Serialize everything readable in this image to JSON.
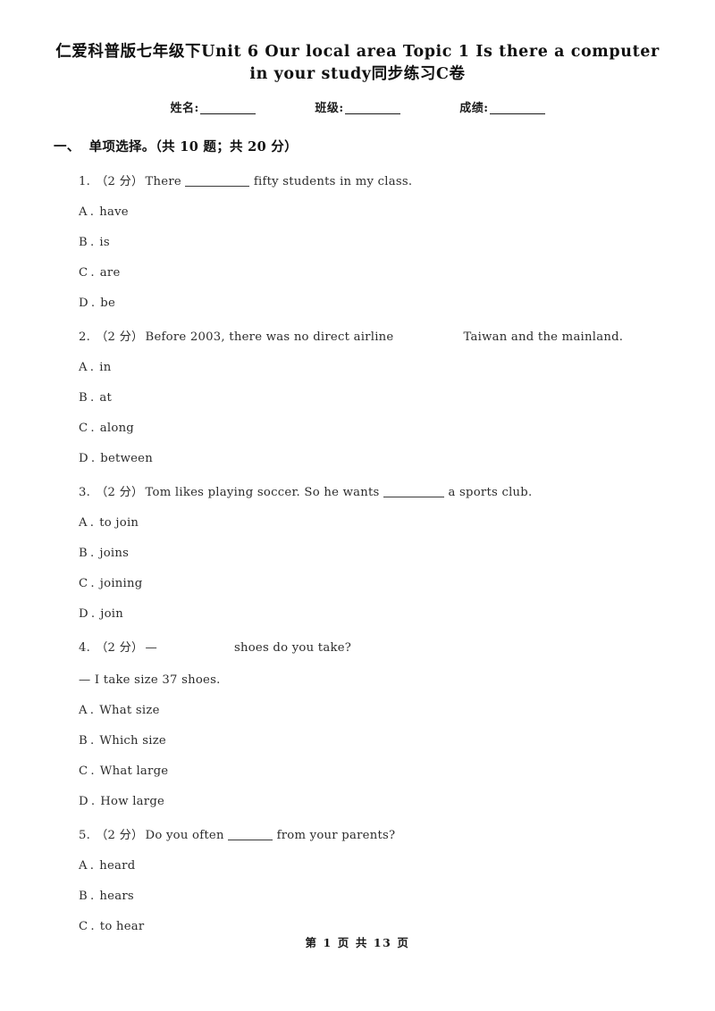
{
  "document": {
    "title": "仁爱科普版七年级下Unit 6 Our local area Topic 1 Is there a computer in your study同步练习C卷",
    "title_line1": "仁爱科普版七年级下Unit 6 Our local area Topic 1 Is there a computer",
    "title_line2": "in your study同步练习C卷"
  },
  "info_line": {
    "name_label": "姓名:",
    "class_label": "班级:",
    "score_label": "成绩:"
  },
  "section": {
    "number": "一、",
    "title": "单项选择。（共 10 题；共 20 分）"
  },
  "questions": [
    {
      "number": "1.",
      "score": "（2 分）",
      "text_before": "There ",
      "blank": "underline-long",
      "text_after": " fifty students in my class.",
      "continuation": null,
      "options": [
        {
          "letter": "A",
          "dot": ".",
          "text": "have"
        },
        {
          "letter": "B",
          "dot": ".",
          "text": "is"
        },
        {
          "letter": "C",
          "dot": ".",
          "text": "are"
        },
        {
          "letter": "D",
          "dot": ".",
          "text": "be"
        }
      ]
    },
    {
      "number": "2.",
      "score": "（2 分）",
      "text_before": "Before 2003, there was no direct airline",
      "blank": "gap-wide",
      "text_after": "Taiwan and the mainland.",
      "continuation": null,
      "options": [
        {
          "letter": "A",
          "dot": ".",
          "text": "in"
        },
        {
          "letter": "B",
          "dot": ".",
          "text": "at"
        },
        {
          "letter": "C",
          "dot": ".",
          "text": "along"
        },
        {
          "letter": "D",
          "dot": ".",
          "text": "between"
        }
      ]
    },
    {
      "number": "3.",
      "score": "（2 分）",
      "text_before": "Tom likes playing soccer. So he wants ",
      "blank": "underline-mid",
      "text_after": " a sports club.",
      "continuation": null,
      "options": [
        {
          "letter": "A",
          "dot": ".",
          "text": "to join"
        },
        {
          "letter": "B",
          "dot": ".",
          "text": "joins"
        },
        {
          "letter": "C",
          "dot": ".",
          "text": "joining"
        },
        {
          "letter": "D",
          "dot": ".",
          "text": "join"
        }
      ]
    },
    {
      "number": "4.",
      "score": "（2 分）",
      "text_before": "—",
      "blank": "gap-mid",
      "text_after": "shoes do you take?",
      "continuation": "— I take size 37 shoes.",
      "options": [
        {
          "letter": "A",
          "dot": ".",
          "text": "What size"
        },
        {
          "letter": "B",
          "dot": ".",
          "text": "Which size"
        },
        {
          "letter": "C",
          "dot": ".",
          "text": "What large"
        },
        {
          "letter": "D",
          "dot": ".",
          "text": "How large"
        }
      ]
    },
    {
      "number": "5.",
      "score": "（2 分）",
      "text_before": "Do you often ",
      "blank": "underline-short",
      "text_after": " from your parents?",
      "continuation": null,
      "options": [
        {
          "letter": "A",
          "dot": ".",
          "text": "heard"
        },
        {
          "letter": "B",
          "dot": ".",
          "text": "hears"
        },
        {
          "letter": "C",
          "dot": ".",
          "text": "to hear"
        }
      ]
    }
  ],
  "footer": {
    "text": "第 1 页 共 13 页"
  }
}
